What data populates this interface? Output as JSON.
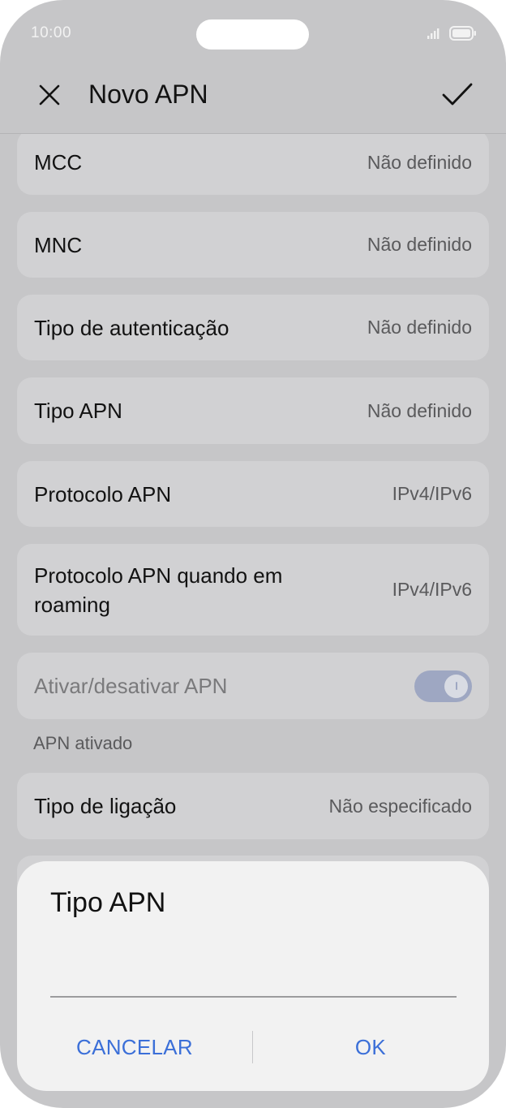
{
  "status": {
    "time": "10:00"
  },
  "header": {
    "title": "Novo APN",
    "close_icon": "close-icon",
    "confirm_icon": "check-icon"
  },
  "settings": [
    {
      "label": "MCC",
      "value": "Não definido"
    },
    {
      "label": "MNC",
      "value": "Não definido"
    },
    {
      "label": "Tipo de autenticação",
      "value": "Não definido"
    },
    {
      "label": "Tipo APN",
      "value": "Não definido"
    },
    {
      "label": "Protocolo APN",
      "value": "IPv4/IPv6"
    },
    {
      "label": "Protocolo APN quando em roaming",
      "value": "IPv4/IPv6"
    }
  ],
  "apn_toggle": {
    "label": "Ativar/desativar APN",
    "enabled": true,
    "disabled_state": true,
    "note": "APN ativado"
  },
  "bearer": {
    "label": "Tipo de ligação",
    "value": "Não especificado"
  },
  "dialog": {
    "title": "Tipo APN",
    "input_value": "",
    "cancel_label": "CANCELAR",
    "ok_label": "OK"
  },
  "colors": {
    "background": "#c6c6c8",
    "card": "#d1d1d3",
    "dialog": "#f2f2f2",
    "accent": "#3b6fd8",
    "toggle_track": "#9ea7c2"
  }
}
